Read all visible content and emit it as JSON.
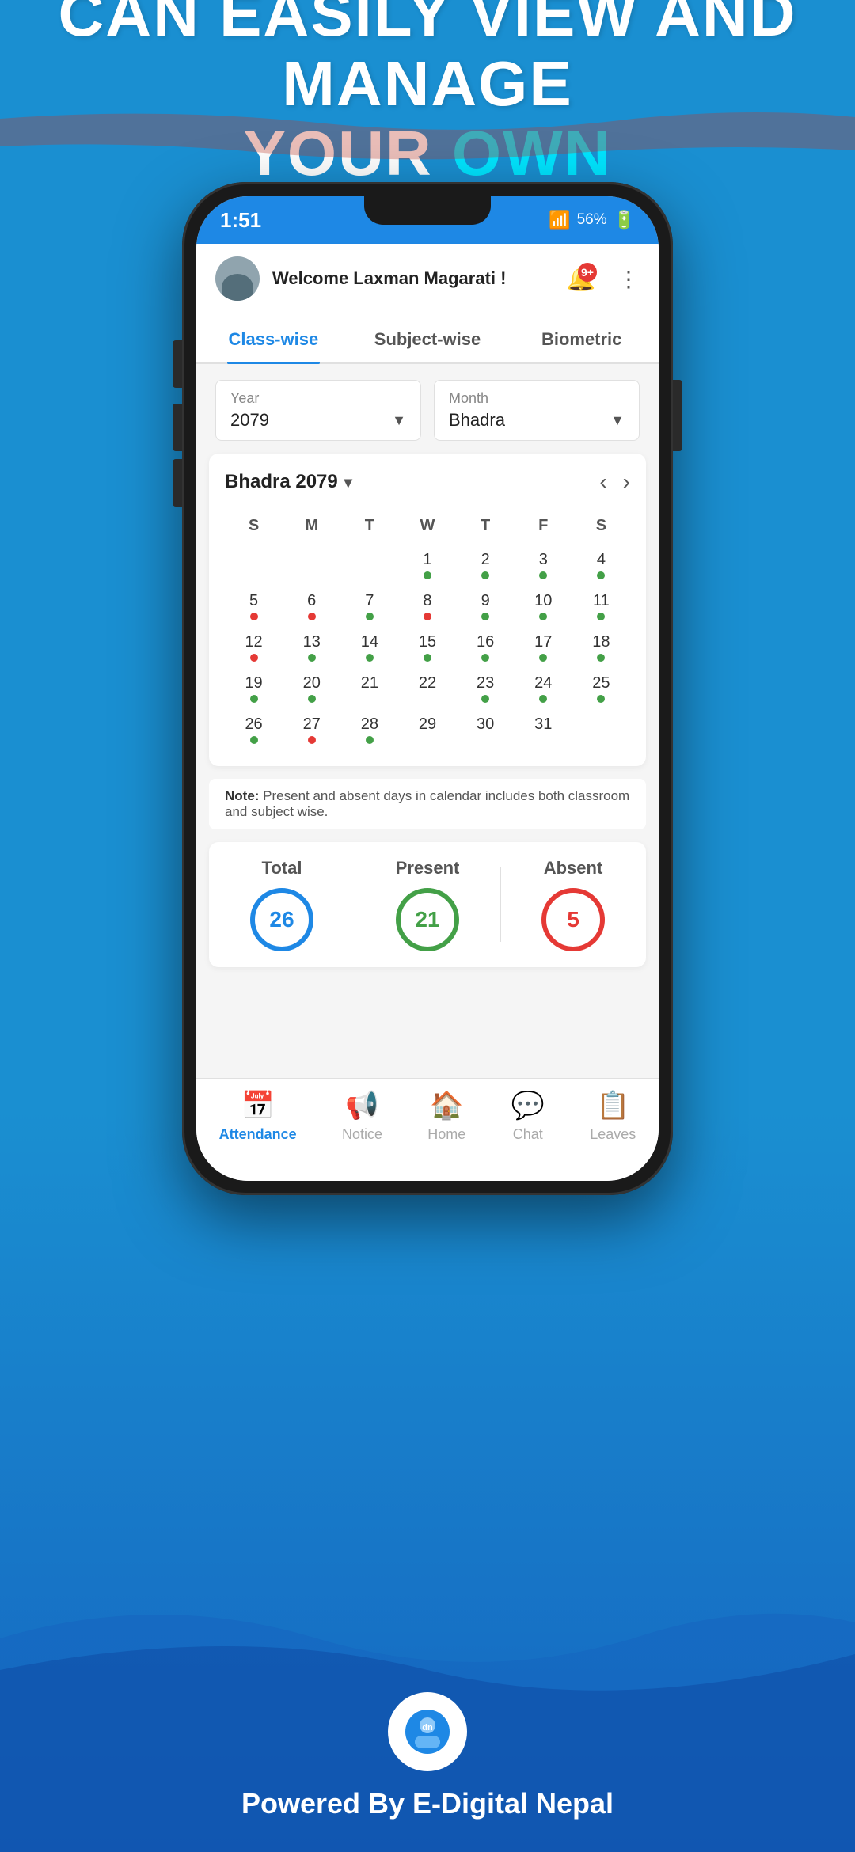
{
  "banner": {
    "line1": "CAN EASILY VIEW AND MANAGE",
    "line2_white": "YOUR ",
    "line2_cyan": "OWN ATTENDANCE"
  },
  "phone": {
    "status": {
      "time": "1:51",
      "signal": "56%"
    },
    "header": {
      "welcome": "Welcome Laxman Magarati !",
      "notif_badge": "9+"
    },
    "tabs": [
      {
        "label": "Class-wise",
        "active": true
      },
      {
        "label": "Subject-wise",
        "active": false
      },
      {
        "label": "Biometric",
        "active": false
      }
    ],
    "filters": {
      "year_label": "Year",
      "year_value": "2079",
      "month_label": "Month",
      "month_value": "Bhadra"
    },
    "calendar": {
      "title": "Bhadra 2079",
      "day_headers": [
        "S",
        "M",
        "T",
        "W",
        "T",
        "F",
        "S"
      ],
      "rows": [
        [
          {
            "day": "",
            "dot": "none"
          },
          {
            "day": "",
            "dot": "none"
          },
          {
            "day": "",
            "dot": "none"
          },
          {
            "day": "1",
            "dot": "green"
          },
          {
            "day": "2",
            "dot": "green"
          },
          {
            "day": "3",
            "dot": "green"
          },
          {
            "day": "4",
            "dot": "green"
          }
        ],
        [
          {
            "day": "5",
            "dot": "red"
          },
          {
            "day": "6",
            "dot": "red"
          },
          {
            "day": "7",
            "dot": "green"
          },
          {
            "day": "8",
            "dot": "red"
          },
          {
            "day": "9",
            "dot": "green"
          },
          {
            "day": "10",
            "dot": "green"
          },
          {
            "day": "11",
            "dot": "green"
          }
        ],
        [
          {
            "day": "12",
            "dot": "red"
          },
          {
            "day": "13",
            "dot": "green"
          },
          {
            "day": "14",
            "dot": "green"
          },
          {
            "day": "15",
            "dot": "green"
          },
          {
            "day": "16",
            "dot": "green"
          },
          {
            "day": "17",
            "dot": "green"
          },
          {
            "day": "18",
            "dot": "green"
          }
        ],
        [
          {
            "day": "19",
            "dot": "green"
          },
          {
            "day": "20",
            "dot": "green"
          },
          {
            "day": "21",
            "dot": "none"
          },
          {
            "day": "22",
            "dot": "none"
          },
          {
            "day": "23",
            "dot": "green"
          },
          {
            "day": "24",
            "dot": "green"
          },
          {
            "day": "25",
            "dot": "green"
          }
        ],
        [
          {
            "day": "26",
            "dot": "green"
          },
          {
            "day": "27",
            "dot": "red"
          },
          {
            "day": "28",
            "dot": "green"
          },
          {
            "day": "29",
            "dot": "none"
          },
          {
            "day": "30",
            "dot": "none"
          },
          {
            "day": "31",
            "dot": "none"
          },
          {
            "day": "",
            "dot": "none"
          }
        ]
      ]
    },
    "note": "Note: Present and absent days in calendar includes both classroom and subject wise.",
    "stats": {
      "total_label": "Total",
      "total_value": "26",
      "present_label": "Present",
      "present_value": "21",
      "absent_label": "Absent",
      "absent_value": "5"
    },
    "bottom_nav": [
      {
        "label": "Attendance",
        "active": true,
        "icon": "📅"
      },
      {
        "label": "Notice",
        "active": false,
        "icon": "📢"
      },
      {
        "label": "Home",
        "active": false,
        "icon": "🏠"
      },
      {
        "label": "Chat",
        "active": false,
        "icon": "💬"
      },
      {
        "label": "Leaves",
        "active": false,
        "icon": "📋"
      }
    ]
  },
  "footer": {
    "powered_by": "Powered By E-Digital Nepal"
  }
}
